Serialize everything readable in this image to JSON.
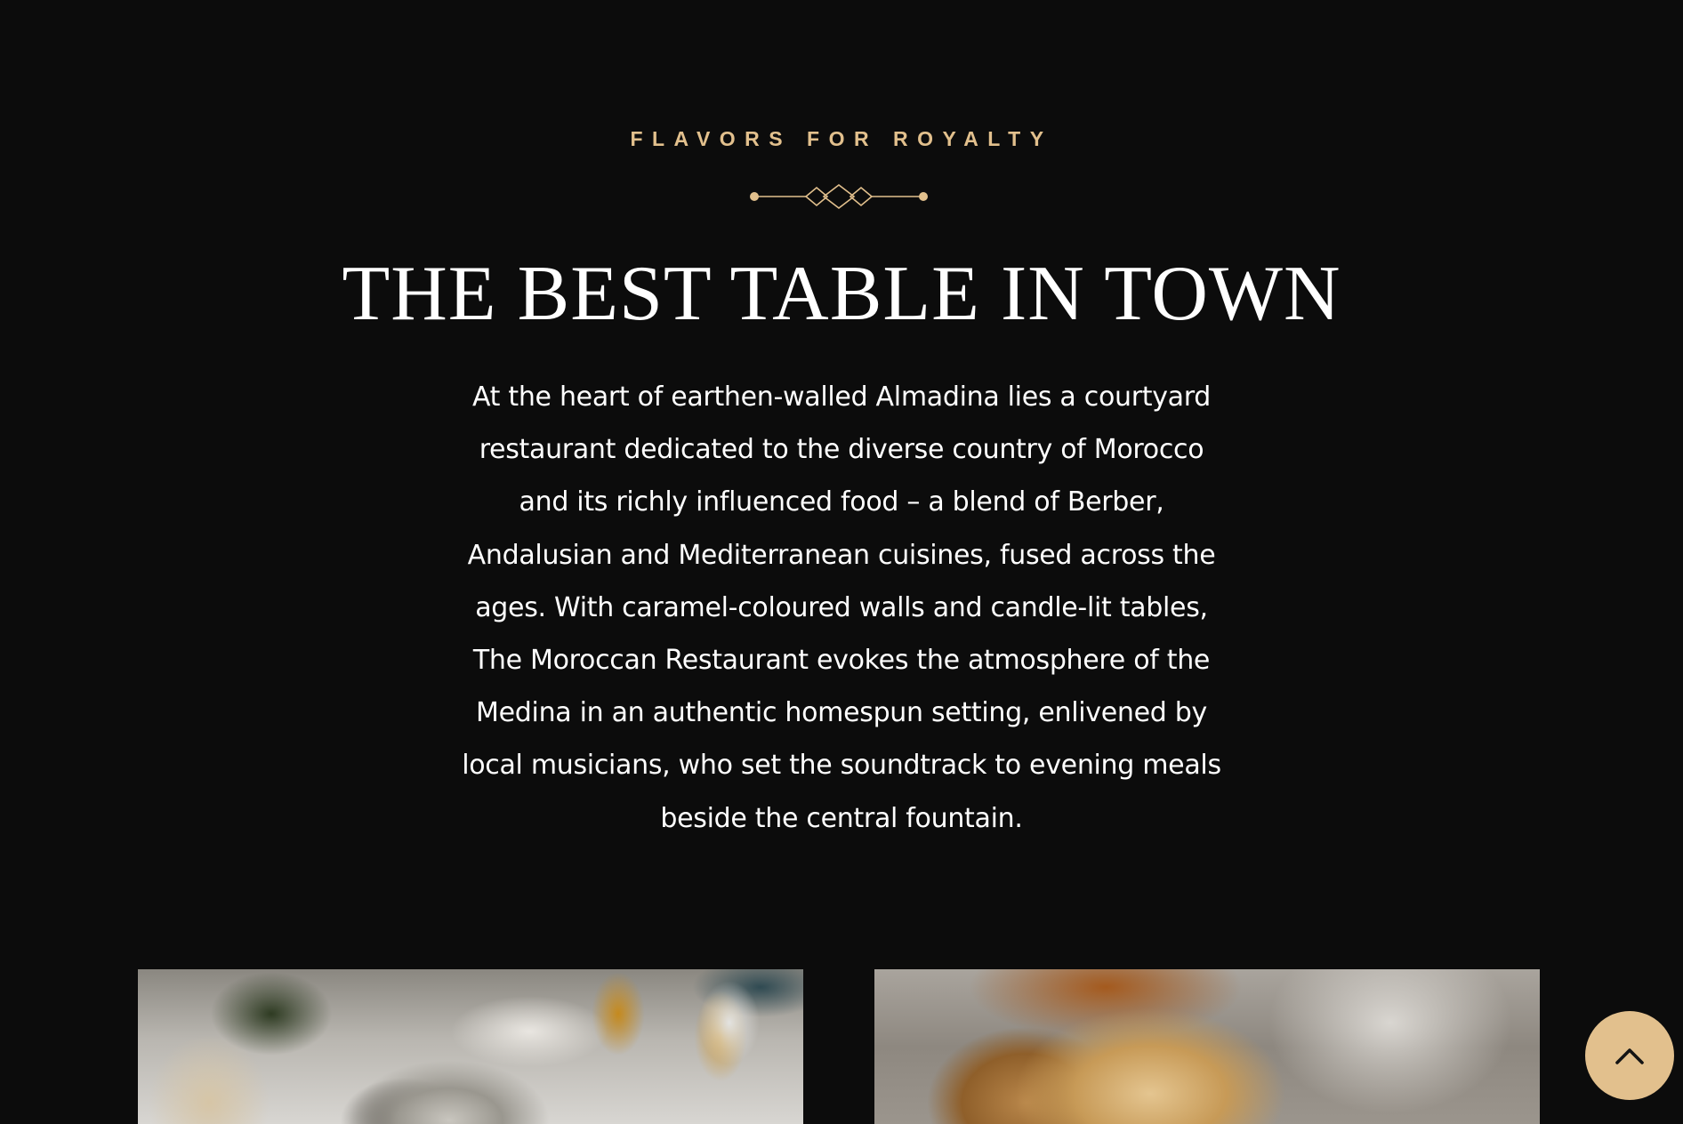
{
  "section": {
    "eyebrow": "FLAVORS FOR ROYALTY",
    "headline": "THE BEST TABLE IN TOWN",
    "body": "At the heart of earthen-walled Almadina lies a courtyard restaurant dedicated to the diverse country of Morocco and its richly influenced food – a blend of Berber, Andalusian and Mediterranean cuisines, fused across the ages. With caramel-coloured walls and candle-lit tables, The Moroccan Restaurant  evokes the atmosphere of the Medina in an authentic homespun setting, enlivened by local musicians, who set the soundtrack to evening meals beside the central fountain."
  },
  "gallery": {
    "images": [
      {
        "subject": "moroccan-breakfast-table-photo"
      },
      {
        "subject": "toasted-bread-photo"
      }
    ]
  },
  "scroll_top": {
    "icon": "chevron-up-icon"
  },
  "colors": {
    "background": "#0c0c0c",
    "accent": "#e2c08d",
    "text": "#ffffff"
  }
}
